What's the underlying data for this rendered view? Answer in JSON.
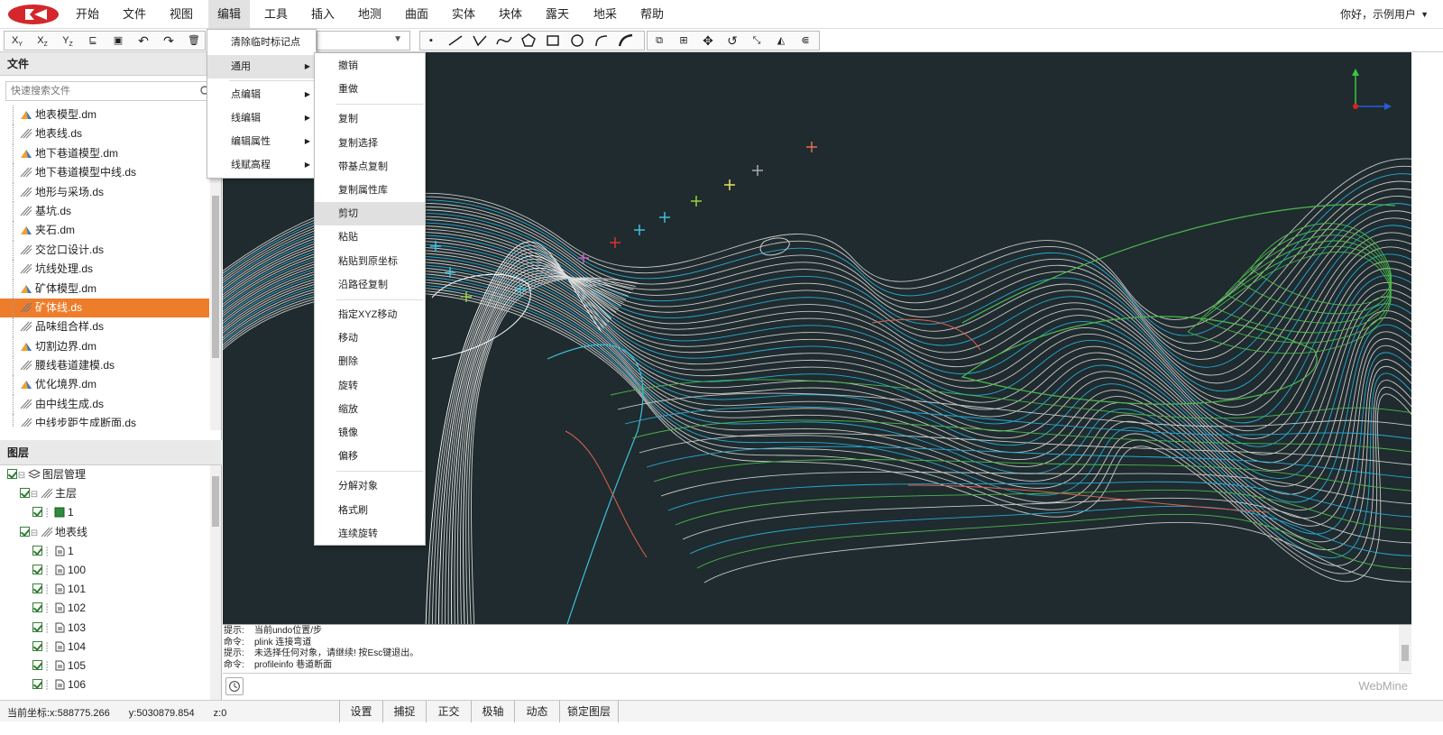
{
  "menubar": {
    "items": [
      "开始",
      "文件",
      "视图",
      "编辑",
      "工具",
      "插入",
      "地测",
      "曲面",
      "实体",
      "块体",
      "露天",
      "地采",
      "帮助"
    ],
    "active": "编辑",
    "user": "你好，示例用户"
  },
  "toolbar": {
    "left_tools": [
      "x-align-icon",
      "y-align-icon",
      "z-align-icon",
      "sort-icon",
      "select-box-icon",
      "undo-icon",
      "redo-icon",
      "delete-icon"
    ],
    "draw_tools": [
      "point-icon",
      "line-icon",
      "polyline-icon",
      "curve-icon",
      "pentagon-icon",
      "rectangle-icon",
      "circle-icon",
      "arc-icon",
      "arc2-icon"
    ],
    "edit_tools": [
      "copy-icon",
      "paste-icon",
      "move-icon",
      "rotate-icon",
      "scale-icon",
      "mirror-icon",
      "offset-icon"
    ]
  },
  "files": {
    "title": "文件",
    "search_placeholder": "快速搜索文件",
    "items": [
      {
        "name": "地表模型.dm",
        "type": "dm",
        "selected": false
      },
      {
        "name": "地表线.ds",
        "type": "ds",
        "selected": false
      },
      {
        "name": "地下巷道模型.dm",
        "type": "dm",
        "selected": false
      },
      {
        "name": "地下巷道模型中线.ds",
        "type": "ds",
        "selected": false
      },
      {
        "name": "地形与采场.ds",
        "type": "ds",
        "selected": false
      },
      {
        "name": "基坑.ds",
        "type": "ds",
        "selected": false
      },
      {
        "name": "夹石.dm",
        "type": "dm",
        "selected": false
      },
      {
        "name": "交岔口设计.ds",
        "type": "ds",
        "selected": false
      },
      {
        "name": "坑线处理.ds",
        "type": "ds",
        "selected": false
      },
      {
        "name": "矿体模型.dm",
        "type": "dm",
        "selected": false
      },
      {
        "name": "矿体线.ds",
        "type": "ds",
        "selected": true
      },
      {
        "name": "品味组合样.ds",
        "type": "ds",
        "selected": false
      },
      {
        "name": "切割边界.dm",
        "type": "dm",
        "selected": false
      },
      {
        "name": "腰线巷道建模.ds",
        "type": "ds",
        "selected": false
      },
      {
        "name": "优化境界.dm",
        "type": "dm",
        "selected": false
      },
      {
        "name": "由中线生成.ds",
        "type": "ds",
        "selected": false
      },
      {
        "name": "中线步距生成断面.ds",
        "type": "ds",
        "selected": false
      }
    ]
  },
  "layers": {
    "title": "图层",
    "rows": [
      {
        "label": "图层管理",
        "level": 0,
        "icon": "layers"
      },
      {
        "label": "主层",
        "level": 1,
        "icon": "lines"
      },
      {
        "label": "1",
        "level": 2,
        "icon": "green"
      },
      {
        "label": "地表线",
        "level": 1,
        "icon": "lines"
      },
      {
        "label": "1",
        "level": 2,
        "icon": "doc"
      },
      {
        "label": "100",
        "level": 2,
        "icon": "doc"
      },
      {
        "label": "101",
        "level": 2,
        "icon": "doc"
      },
      {
        "label": "102",
        "level": 2,
        "icon": "doc"
      },
      {
        "label": "103",
        "level": 2,
        "icon": "doc"
      },
      {
        "label": "104",
        "level": 2,
        "icon": "doc"
      },
      {
        "label": "105",
        "level": 2,
        "icon": "doc"
      },
      {
        "label": "106",
        "level": 2,
        "icon": "doc"
      }
    ]
  },
  "edit_menu": {
    "items": [
      {
        "label": "清除临时标记点",
        "submenu": false
      },
      {
        "label": "通用",
        "submenu": true,
        "highlight": true
      },
      {
        "label": "点编辑",
        "submenu": true
      },
      {
        "label": "线编辑",
        "submenu": true
      },
      {
        "label": "编辑属性",
        "submenu": true
      },
      {
        "label": "线赋高程",
        "submenu": true
      }
    ]
  },
  "submenu": {
    "items": [
      "撤销",
      "重做",
      "复制",
      "复制选择",
      "带基点复制",
      "复制属性库",
      "剪切",
      "粘贴",
      "粘贴到原坐标",
      "沿路径复制",
      "指定XYZ移动",
      "移动",
      "删除",
      "旋转",
      "缩放",
      "镜像",
      "偏移",
      "分解对象",
      "格式刷",
      "连续旋转"
    ],
    "highlighted": "剪切"
  },
  "command": {
    "lines": [
      {
        "key": "提示:",
        "text": "当前undo位置/步"
      },
      {
        "key": "命令:",
        "text": "plink 连接弯道"
      },
      {
        "key": "提示:",
        "text": "未选择任何对象，请继续! 按Esc键退出。"
      },
      {
        "key": "命令:",
        "text": "profileinfo 巷道断面"
      }
    ],
    "brand": "WebMine"
  },
  "status": {
    "x": "当前坐标:x:588775.266",
    "y": "y:5030879.854",
    "z": "z:0",
    "buttons": [
      "设置",
      "捕捉",
      "正交",
      "极轴",
      "动态",
      "锁定图层"
    ]
  },
  "colors": {
    "accent": "#ee7d2b",
    "canvas_bg": "#1f2b2e",
    "logo_red": "#d3272b"
  }
}
